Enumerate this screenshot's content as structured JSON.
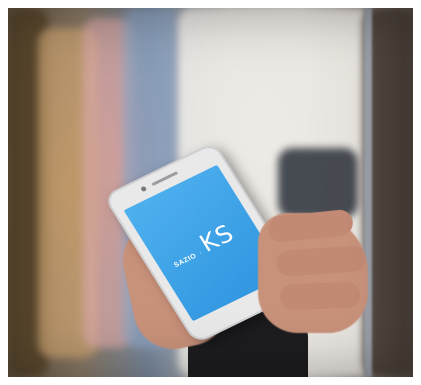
{
  "phone_screen": {
    "logo_prefix": "SAZIO",
    "logo_separator": "·",
    "logo_main": "KS",
    "screen_color": "#3aa0e8"
  }
}
